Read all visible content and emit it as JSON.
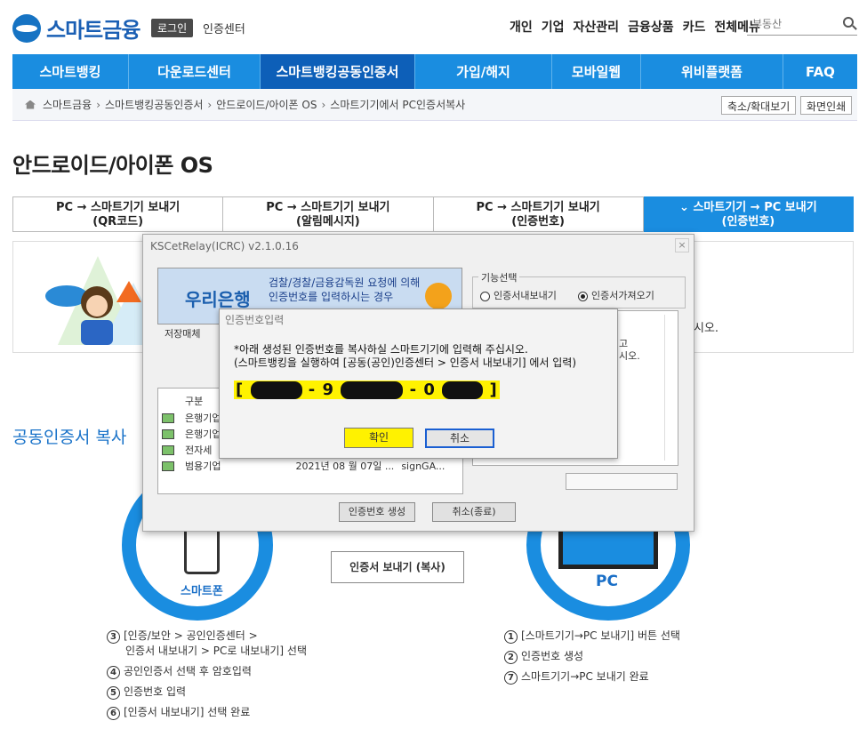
{
  "header": {
    "logo_text": "스마트금융",
    "login_badge": "로그인",
    "cert_center": "인증센터",
    "top_menu": [
      "개인",
      "기업",
      "자산관리",
      "금융상품",
      "카드",
      "전체메뉴"
    ],
    "search_value": "부동산"
  },
  "nav": [
    "스마트뱅킹",
    "다운로드센터",
    "스마트뱅킹공동인증서",
    "가입/해지",
    "모바일웹",
    "위비플랫폼",
    "FAQ"
  ],
  "breadcrumb": [
    "스마트금융",
    "스마트뱅킹공동인증서",
    "안드로이드/아이폰 OS",
    "스마트기기에서 PC인증서복사"
  ],
  "tools": {
    "zoom": "축소/확대보기",
    "print": "화면인쇄"
  },
  "page_title": "안드로이드/아이폰 OS",
  "tabs": [
    {
      "line1": "PC → 스마트기기 보내기",
      "line2": "(QR코드)"
    },
    {
      "line1": "PC → 스마트기기 보내기",
      "line2": "(알림메시지)"
    },
    {
      "line1": "PC → 스마트기기 보내기",
      "line2": "(인증번호)"
    },
    {
      "line1": "스마트기기 → PC 보내기",
      "line2": "(인증번호)"
    }
  ],
  "info_text_tail": "시오.",
  "section_title": "공동인증서 복사",
  "phone_label": "스마트폰",
  "pc_label": "PC",
  "arrow_label": "인증서 보내기 (복사)",
  "steps_left": [
    {
      "n": "3",
      "text": "[인증/보안 > 공인인증센터 >"
    },
    {
      "n": "",
      "text": "인증서 내보내기 > PC로 내보내기] 선택"
    },
    {
      "n": "4",
      "text": "공인인증서 선택 후 암호입력"
    },
    {
      "n": "5",
      "text": "인증번호 입력"
    },
    {
      "n": "6",
      "text": "[인증서 내보내기] 선택 완료"
    }
  ],
  "steps_right": [
    {
      "n": "1",
      "text": "[스마트기기→PC 보내기] 버튼 선택"
    },
    {
      "n": "2",
      "text": "인증번호 생성"
    },
    {
      "n": "7",
      "text": "스마트기기→PC 보내기 완료"
    }
  ],
  "kscet": {
    "title": "KSCetRelay(ICRC) v2.1.0.16",
    "close": "×",
    "bank_name": "우리은행",
    "banner_line1": "검찰/경찰/금융감독원 요청에 의해",
    "banner_line2": "인증번호를 입력하시는 경우",
    "func_label": "기능선택",
    "radio_export": "인증서내보내기",
    "radio_import": "인증서가져오기",
    "storage_label": "저장매체",
    "list_header": "구분",
    "list_rows": [
      "은행기업",
      "은행기업",
      "전자세",
      "범용기업"
    ],
    "list_date": "2021년 08 월 07일 ...",
    "list_issuer": "signGA...",
    "right_text_a": "고",
    "right_text_b": "시오.",
    "gen_button": "인증번호 생성",
    "cancel_end_button": "취소(종료)"
  },
  "auth_dialog": {
    "title": "인증번호입력",
    "msg1": "*아래 생성된 인증번호를 복사하실 스마트기기에 입력해 주십시오.",
    "msg2": "(스마트뱅킹을 실행하여 [공동(공인)인증센터 > 인증서 내보내기] 에서 입력)",
    "code_open": "[",
    "code_dash1": "- 9",
    "code_dash2": "- 0",
    "code_close": "]",
    "ok": "확인",
    "cancel": "취소"
  }
}
